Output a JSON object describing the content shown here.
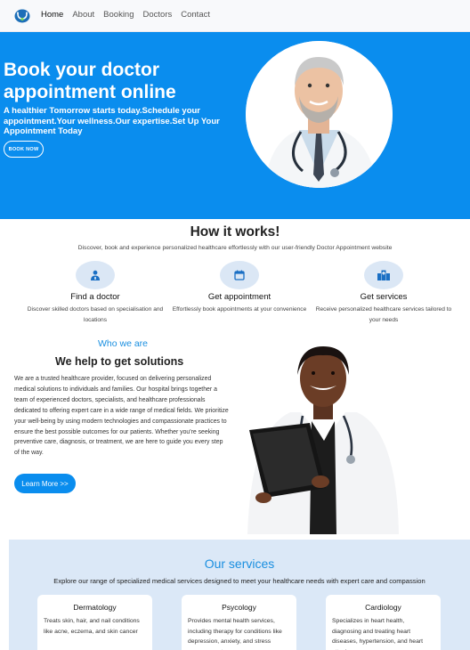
{
  "nav": {
    "logo_icon": "stethoscope-logo-icon",
    "items": [
      {
        "label": "Home",
        "active": true
      },
      {
        "label": "About",
        "active": false
      },
      {
        "label": "Booking",
        "active": false
      },
      {
        "label": "Doctors",
        "active": false
      },
      {
        "label": "Contact",
        "active": false
      }
    ]
  },
  "hero": {
    "title": "Book your doctor appointment online",
    "subtitle": "A healthier Tomorrow starts today.Schedule your appointment.Your wellness.Our expertise.Set Up Your Appointment Today",
    "button_label": "BOOK NOW",
    "photo": "male-doctor-photo",
    "bg_color": "#0a8dee"
  },
  "how": {
    "title": "How it works!",
    "subtitle": "Discover, book and experience personalized healthcare effortlessly with our user-friendly Doctor Appointment website",
    "steps": [
      {
        "icon": "doctor-icon",
        "title": "Find a doctor",
        "desc": "Discover skilled doctors based on specialisation and locations"
      },
      {
        "icon": "calendar-icon",
        "title": "Get appointment",
        "desc": "Effortlessly book appointments at your convenience"
      },
      {
        "icon": "hospital-icon",
        "title": "Get services",
        "desc": "Receive personalized healthcare services tailored to your needs"
      }
    ]
  },
  "who": {
    "tag": "Who we are",
    "title": "We help to get solutions",
    "text": "We are a trusted healthcare provider, focused on delivering personalized medical solutions to individuals and families. Our hospital brings together a team of experienced doctors, specialists, and healthcare professionals dedicated to offering expert care in a wide range of medical fields. We prioritize your well-being by using modern technologies and compassionate practices to ensure the best possible outcomes for our patients. Whether you're seeking preventive care, diagnosis, or treatment, we are here to guide you every step of the way.",
    "button_label": "Learn More >>",
    "photo": "female-doctor-photo"
  },
  "services": {
    "title": "Our services",
    "subtitle": "Explore our range of specialized medical services designed to meet your healthcare needs with expert care and compassion",
    "cards": [
      {
        "title": "Dermatology",
        "text": "Treats skin, hair, and nail conditions like acne, eczema, and skin cancer"
      },
      {
        "title": "Psycology",
        "text": "Provides mental health services, including therapy for conditions like depression, anxiety, and stress management."
      },
      {
        "title": "Cardiology",
        "text": "Specializes in heart health, diagnosing and treating heart diseases, hypertension, and heart attacks."
      }
    ]
  },
  "colors": {
    "accent": "#0a8dee",
    "heading_blue": "#1a8fe0",
    "services_bg": "#dbe8f7",
    "icon_bg": "#dbe7f5"
  }
}
